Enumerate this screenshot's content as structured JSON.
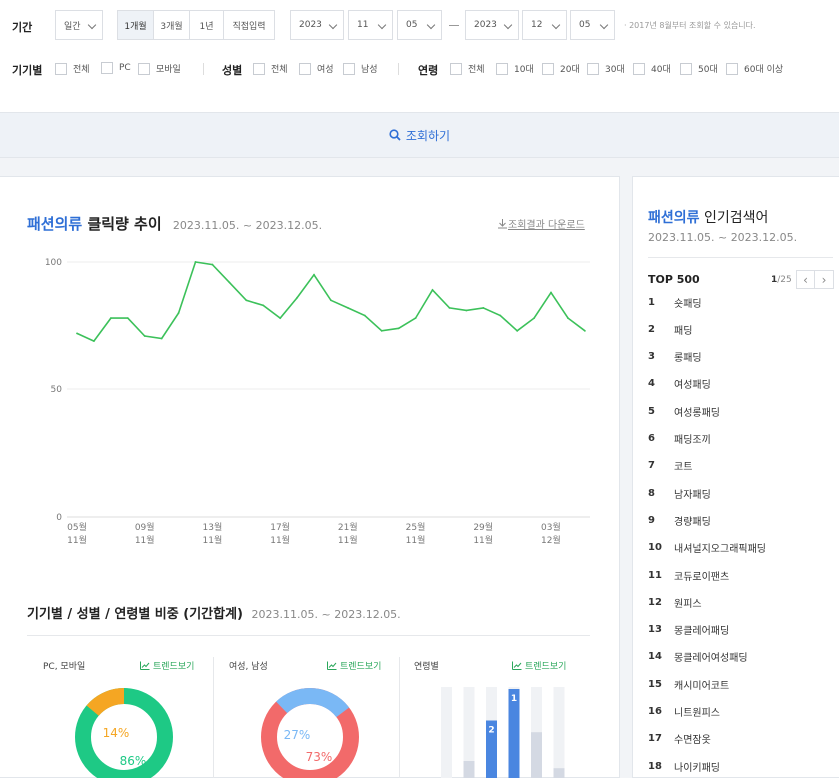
{
  "filters": {
    "period_label": "기간",
    "period_unit": "일간",
    "period_buttons": [
      "1개월",
      "3개월",
      "1년",
      "직접입력"
    ],
    "start_year": "2023",
    "start_month": "11",
    "start_day": "05",
    "end_year": "2023",
    "end_month": "12",
    "end_day": "05",
    "note": "· 2017년 8월부터 조회할 수 있습니다.",
    "device_label": "기기별",
    "device_options": [
      "전체",
      "PC",
      "모바일"
    ],
    "gender_label": "성별",
    "gender_options": [
      "전체",
      "여성",
      "남성"
    ],
    "age_label": "연령",
    "age_options": [
      "전체",
      "10대",
      "20대",
      "30대",
      "40대",
      "50대",
      "60대 이상"
    ]
  },
  "search_button": "조회하기",
  "click_trend": {
    "title_category": "패션의류",
    "title_rest": "클릭량 추이",
    "date_range": "2023.11.05. ~ 2023.12.05.",
    "download_label": "조회결과 다운로드",
    "y_ticks": [
      "100",
      "50",
      "0"
    ],
    "x_ticks": [
      {
        "top": "05월",
        "bottom": "11월"
      },
      {
        "top": "09월",
        "bottom": "11월"
      },
      {
        "top": "13월",
        "bottom": "11월"
      },
      {
        "top": "17월",
        "bottom": "11월"
      },
      {
        "top": "21월",
        "bottom": "11월"
      },
      {
        "top": "25월",
        "bottom": "11월"
      },
      {
        "top": "29월",
        "bottom": "11월"
      },
      {
        "top": "03월",
        "bottom": "12월"
      }
    ]
  },
  "chart_data": {
    "type": "line",
    "x": [
      "11.05",
      "11.06",
      "11.07",
      "11.08",
      "11.09",
      "11.10",
      "11.11",
      "11.12",
      "11.13",
      "11.14",
      "11.15",
      "11.16",
      "11.17",
      "11.18",
      "11.19",
      "11.20",
      "11.21",
      "11.22",
      "11.23",
      "11.24",
      "11.25",
      "11.26",
      "11.27",
      "11.28",
      "11.29",
      "11.30",
      "12.01",
      "12.02",
      "12.03",
      "12.04",
      "12.05"
    ],
    "values": [
      72,
      69,
      78,
      78,
      71,
      70,
      80,
      100,
      99,
      92,
      85,
      83,
      78,
      86,
      95,
      85,
      82,
      79,
      73,
      74,
      78,
      89,
      82,
      81,
      82,
      79,
      73,
      78,
      88,
      78,
      73
    ],
    "ylim": [
      0,
      100
    ],
    "grid": true,
    "color": "#3cc15a"
  },
  "share": {
    "title": "기기별 / 성별 / 연령별 비중 (기간합계)",
    "date_range": "2023.11.05. ~ 2023.12.05.",
    "trend_label": "트렌드보기",
    "device": {
      "title": "PC, 모바일",
      "pc_pct": "14%",
      "mobile_pct": "86%",
      "pc": 14,
      "mobile": 86,
      "pc_color": "#f5a623",
      "mobile_color": "#1ec985"
    },
    "gender": {
      "title": "여성, 남성",
      "male_pct": "27%",
      "female_pct": "73%",
      "male": 27,
      "female": 73,
      "male_color": "#7ab8f5",
      "female_color": "#f26a6a"
    },
    "age": {
      "title": "연령별",
      "badges": [
        "1",
        "2"
      ],
      "fills": [
        0,
        0.2,
        0.65,
        1.0,
        0.52,
        0.12
      ],
      "highlight_color": "#4a86e0"
    }
  },
  "popular": {
    "title_category": "패션의류",
    "title_rest": "인기검색어",
    "date_range": "2023.11.05. ~ 2023.12.05.",
    "top_label": "TOP 500",
    "page_current": "1",
    "page_total": "/25",
    "keywords": [
      {
        "rank": "1",
        "text": "숏패딩"
      },
      {
        "rank": "2",
        "text": "패딩"
      },
      {
        "rank": "3",
        "text": "롱패딩"
      },
      {
        "rank": "4",
        "text": "여성패딩"
      },
      {
        "rank": "5",
        "text": "여성롱패딩"
      },
      {
        "rank": "6",
        "text": "패딩조끼"
      },
      {
        "rank": "7",
        "text": "코트"
      },
      {
        "rank": "8",
        "text": "남자패딩"
      },
      {
        "rank": "9",
        "text": "경량패딩"
      },
      {
        "rank": "10",
        "text": "내셔널지오그래픽패딩"
      },
      {
        "rank": "11",
        "text": "코듀로이팬츠"
      },
      {
        "rank": "12",
        "text": "원피스"
      },
      {
        "rank": "13",
        "text": "몽클레어패딩"
      },
      {
        "rank": "14",
        "text": "몽클레어여성패딩"
      },
      {
        "rank": "15",
        "text": "캐시미어코트"
      },
      {
        "rank": "16",
        "text": "니트원피스"
      },
      {
        "rank": "17",
        "text": "수면잠옷"
      },
      {
        "rank": "18",
        "text": "나이키패딩"
      }
    ]
  }
}
